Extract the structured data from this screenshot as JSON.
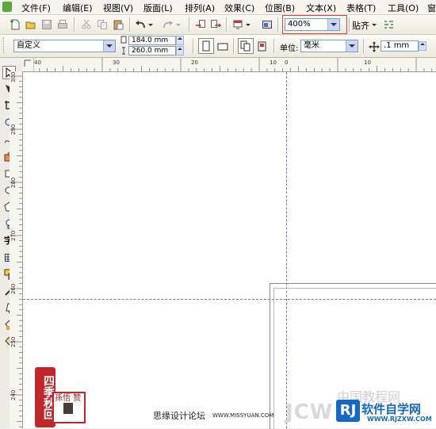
{
  "menu": {
    "items": [
      "文件(F)",
      "编辑(E)",
      "视图(V)",
      "版面(L)",
      "排列(A)",
      "效果(C)",
      "位图(B)",
      "文本(X)",
      "表格(T)",
      "工具(O)",
      "窗"
    ]
  },
  "toolbar1": {
    "zoom_value": "400%",
    "snap_label": "贴齐"
  },
  "toolbar2": {
    "page_preset": "自定义",
    "width": "184.0 mm",
    "height": "260.0 mm",
    "unit_label": "单位:",
    "unit_value": "毫米",
    "nudge_value": ".1 mm"
  },
  "hruler": {
    "ticks": [
      "40",
      "30",
      "20",
      "10",
      "0",
      "10"
    ]
  },
  "vruler": {
    "ticks": [
      "300",
      "290",
      "280",
      "270",
      "260",
      "250",
      "240"
    ]
  },
  "tools": {
    "text_tool_label": "字"
  },
  "watermarks": {
    "seal_text": "四季秋回",
    "seal_box_text": "孫悟 赞 窈",
    "forum": "思缘设计论坛",
    "forum_url": "WWW.MISSYUAN.COM",
    "jcw_text": "JCW",
    "brand_text": "中国教程网",
    "brand_main": "软件自学网",
    "brand_url": "WWW.RJZXW.COM"
  },
  "colors": {
    "zoom_highlight": "#e0463a",
    "guide": "#6677cc",
    "brand_blue": "#1468c8"
  }
}
